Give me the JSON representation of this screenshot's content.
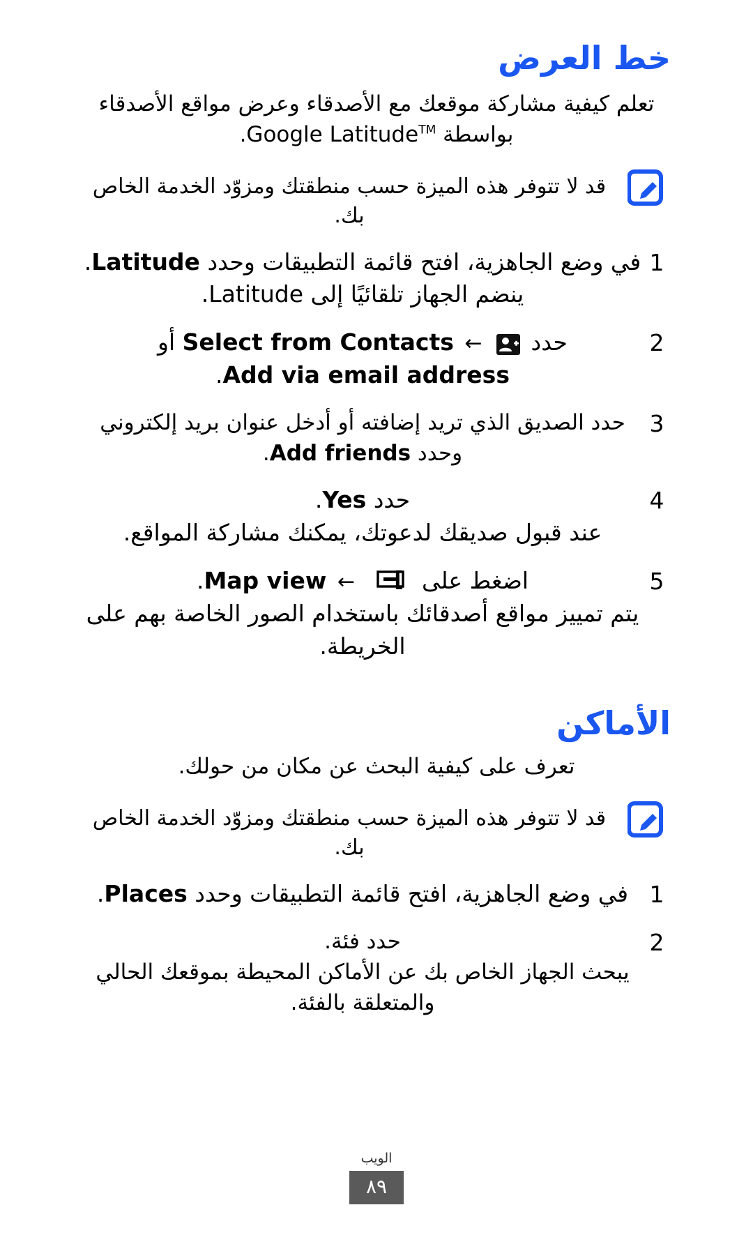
{
  "page": {
    "language": "ar",
    "direction": "rtl",
    "heading_color": "#1a56f0",
    "footer_box_color": "#5a5a5a"
  },
  "latitude_section": {
    "heading": "خط العرض",
    "intro": "تعلم كيفية مشاركة موقعك مع الأصدقاء وعرض مواقع الأصدقاء بواسطة",
    "intro_brand": "Google Latitude",
    "intro_tm": "TM",
    "intro_end": ".",
    "note": "قد لا تتوفر هذه الميزة حسب منطقتك ومزوّد الخدمة الخاص بك.",
    "note_icon": "note-pencil-icon",
    "steps": [
      {
        "num": "1",
        "pre": "في وضع الجاهزية، افتح قائمة التطبيقات وحدد",
        "bold": "Latitude",
        "post": ".",
        "sub": "ينضم الجهاز تلقائيًا إلى Latitude."
      },
      {
        "num": "2",
        "pre": "حدد",
        "icon": "add-contact-icon",
        "arrow": "←",
        "bold": "Select from Contacts",
        "mid": "أو",
        "bold2": "Add via email address",
        "post": "."
      },
      {
        "num": "3",
        "pre": "حدد الصديق الذي تريد إضافته أو أدخل عنوان بريد إلكتروني وحدد",
        "bold": "Add friends",
        "post": "."
      },
      {
        "num": "4",
        "pre": "حدد",
        "bold": "Yes",
        "post": ".",
        "sub": "عند قبول صديقك لدعوتك، يمكنك مشاركة المواقع."
      },
      {
        "num": "5",
        "pre": "اضغط على",
        "icon": "menu-key-icon",
        "arrow": "←",
        "bold": "Map view",
        "post": ".",
        "sub": "يتم تمييز مواقع أصدقائك باستخدام الصور الخاصة بهم على الخريطة."
      }
    ]
  },
  "places_section": {
    "heading": "الأماكن",
    "intro": "تعرف على كيفية البحث عن مكان من حولك.",
    "note": "قد لا تتوفر هذه الميزة حسب منطقتك ومزوّد الخدمة الخاص بك.",
    "note_icon": "note-pencil-icon",
    "steps": [
      {
        "num": "1",
        "pre": "في وضع الجاهزية، افتح قائمة التطبيقات وحدد",
        "bold": "Places",
        "post": "."
      },
      {
        "num": "2",
        "pre": "حدد فئة.",
        "sub": "يبحث الجهاز الخاص بك عن الأماكن المحيطة بموقعك الحالي والمتعلقة بالفئة."
      }
    ]
  },
  "footer": {
    "label": "الويب",
    "page_number": "٨٩"
  }
}
